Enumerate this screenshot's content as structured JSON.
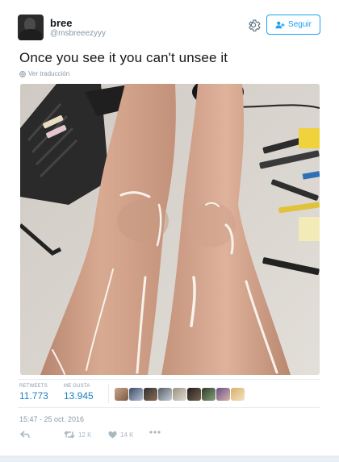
{
  "tweet": {
    "display_name": "bree",
    "handle": "@msbreeezyyy",
    "follow_label": "Seguir",
    "text": "Once you see it you can't unsee it",
    "translate_label": "Ver traducción",
    "retweets_label": "RETWEETS",
    "retweets_count": "11.773",
    "likes_label": "ME GUSTA",
    "likes_count": "13.945",
    "timestamp": "15:47 - 25 oct. 2016",
    "retweet_action_count": "12 K",
    "like_action_count": "14 K"
  },
  "icons": [
    "gear-icon",
    "follow-person-icon",
    "globe-icon",
    "reply-icon",
    "retweet-icon",
    "heart-icon",
    "more-icon"
  ],
  "colors": {
    "accent": "#1da1f2",
    "count_blue": "#1d7fc4",
    "muted": "#8899a6",
    "action_gray": "#aab8c2"
  }
}
